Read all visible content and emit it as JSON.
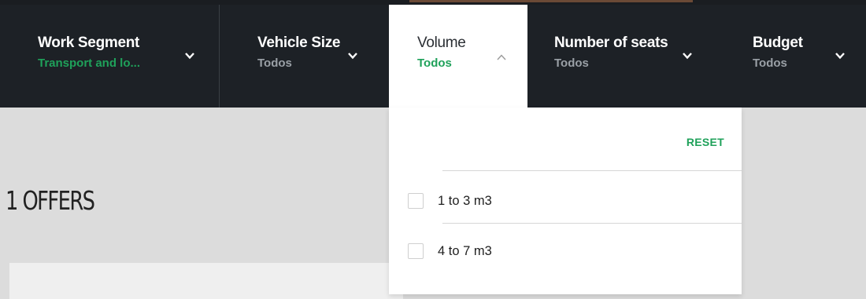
{
  "filters": [
    {
      "title": "Work Segment",
      "value": "Transport and lo...",
      "state": "collapsed"
    },
    {
      "title": "Vehicle Size",
      "value": "Todos",
      "state": "collapsed"
    },
    {
      "title": "Volume",
      "value": "Todos",
      "state": "expanded"
    },
    {
      "title": "Number of seats",
      "value": "Todos",
      "state": "collapsed"
    },
    {
      "title": "Budget",
      "value": "Todos",
      "state": "collapsed"
    }
  ],
  "results": {
    "count_label": "1 OFFERS"
  },
  "dropdown": {
    "reset_label": "RESET",
    "options": [
      {
        "label": "1 to 3 m3",
        "checked": false
      },
      {
        "label": "4 to 7 m3",
        "checked": false
      }
    ]
  },
  "colors": {
    "bar_bg": "#1d2126",
    "accent_green": "#1fa15a",
    "page_bg": "#dcdcdc"
  }
}
